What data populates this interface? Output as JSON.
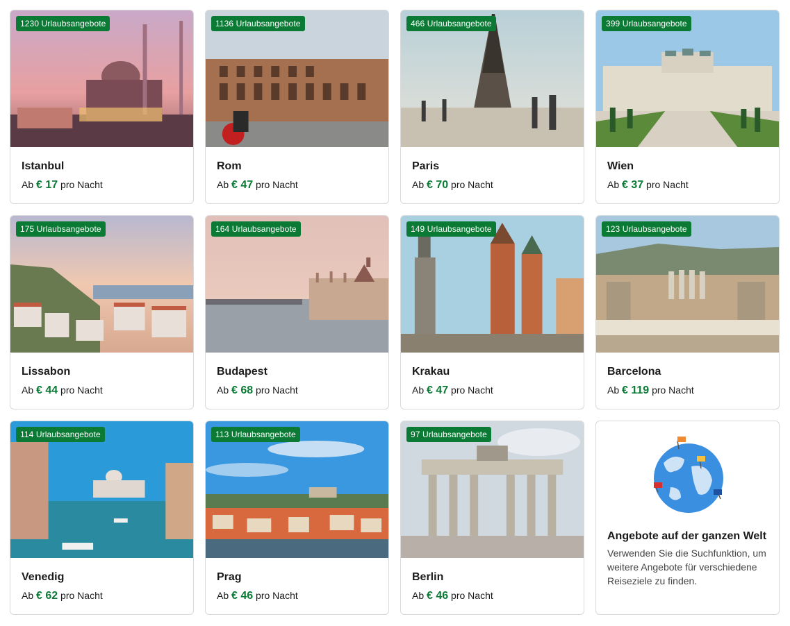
{
  "cards": [
    {
      "city": "Istanbul",
      "offers": "1230 Urlaubsangebote",
      "prefix": "Ab",
      "amount": "€ 17",
      "suffix": "pro Nacht"
    },
    {
      "city": "Rom",
      "offers": "1136 Urlaubsangebote",
      "prefix": "Ab",
      "amount": "€ 47",
      "suffix": "pro Nacht"
    },
    {
      "city": "Paris",
      "offers": "466 Urlaubsangebote",
      "prefix": "Ab",
      "amount": "€ 70",
      "suffix": "pro Nacht"
    },
    {
      "city": "Wien",
      "offers": "399 Urlaubsangebote",
      "prefix": "Ab",
      "amount": "€ 37",
      "suffix": "pro Nacht"
    },
    {
      "city": "Lissabon",
      "offers": "175 Urlaubsangebote",
      "prefix": "Ab",
      "amount": "€ 44",
      "suffix": "pro Nacht"
    },
    {
      "city": "Budapest",
      "offers": "164 Urlaubsangebote",
      "prefix": "Ab",
      "amount": "€ 68",
      "suffix": "pro Nacht"
    },
    {
      "city": "Krakau",
      "offers": "149 Urlaubsangebote",
      "prefix": "Ab",
      "amount": "€ 47",
      "suffix": "pro Nacht"
    },
    {
      "city": "Barcelona",
      "offers": "123 Urlaubsangebote",
      "prefix": "Ab",
      "amount": "€ 119",
      "suffix": "pro Nacht"
    },
    {
      "city": "Venedig",
      "offers": "114 Urlaubsangebote",
      "prefix": "Ab",
      "amount": "€ 62",
      "suffix": "pro Nacht"
    },
    {
      "city": "Prag",
      "offers": "113 Urlaubsangebote",
      "prefix": "Ab",
      "amount": "€ 46",
      "suffix": "pro Nacht"
    },
    {
      "city": "Berlin",
      "offers": "97 Urlaubsangebote",
      "prefix": "Ab",
      "amount": "€ 46",
      "suffix": "pro Nacht"
    }
  ],
  "world": {
    "title": "Angebote auf der ganzen Welt",
    "text": "Verwenden Sie die Suchfunktion, um weitere Angebote für verschiedene Reiseziele zu finden.",
    "icon": "globe-with-flags-icon"
  },
  "colors": {
    "accent": "#0a7a35",
    "border": "#d9d9d9"
  }
}
